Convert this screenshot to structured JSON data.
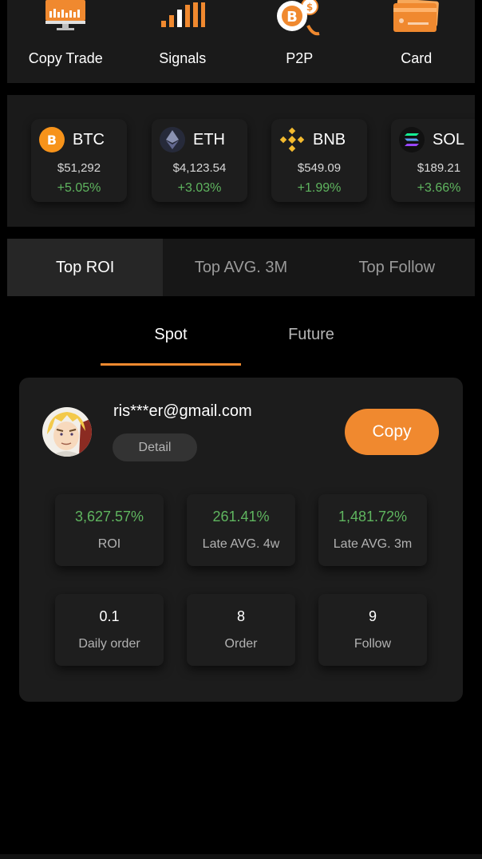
{
  "quick_actions": [
    {
      "label": "Copy Trade",
      "icon": "monitor-chart-icon"
    },
    {
      "label": "Signals",
      "icon": "signal-bars-icon"
    },
    {
      "label": "P2P",
      "icon": "bitcoin-exchange-icon"
    },
    {
      "label": "Card",
      "icon": "credit-card-icon"
    }
  ],
  "tickers": [
    {
      "symbol": "BTC",
      "price": "$51,292",
      "change": "+5.05%",
      "icon": "bitcoin-icon",
      "color": "#f7931a"
    },
    {
      "symbol": "ETH",
      "price": "$4,123.54",
      "change": "+3.03%",
      "icon": "ethereum-icon",
      "color": "#8a92b2"
    },
    {
      "symbol": "BNB",
      "price": "$549.09",
      "change": "+1.99%",
      "icon": "bnb-icon",
      "color": "#f3ba2f"
    },
    {
      "symbol": "SOL",
      "price": "$189.21",
      "change": "+3.66%",
      "icon": "solana-icon",
      "color": "#14f195"
    }
  ],
  "top_tabs": [
    "Top ROI",
    "Top AVG. 3M",
    "Top Follow"
  ],
  "sub_tabs": [
    "Spot",
    "Future"
  ],
  "trader": {
    "email": "ris***er@gmail.com",
    "detail_label": "Detail",
    "copy_label": "Copy",
    "stats": [
      {
        "value": "3,627.57%",
        "label": "ROI"
      },
      {
        "value": "261.41%",
        "label": "Late AVG. 4w"
      },
      {
        "value": "1,481.72%",
        "label": "Late AVG. 3m"
      },
      {
        "value": "0.1",
        "label": "Daily order"
      },
      {
        "value": "8",
        "label": "Order"
      },
      {
        "value": "9",
        "label": "Follow"
      }
    ]
  },
  "colors": {
    "accent": "#f0892f",
    "positive": "#5fb55f",
    "background": "#000000",
    "panel": "#1a1a1a"
  }
}
